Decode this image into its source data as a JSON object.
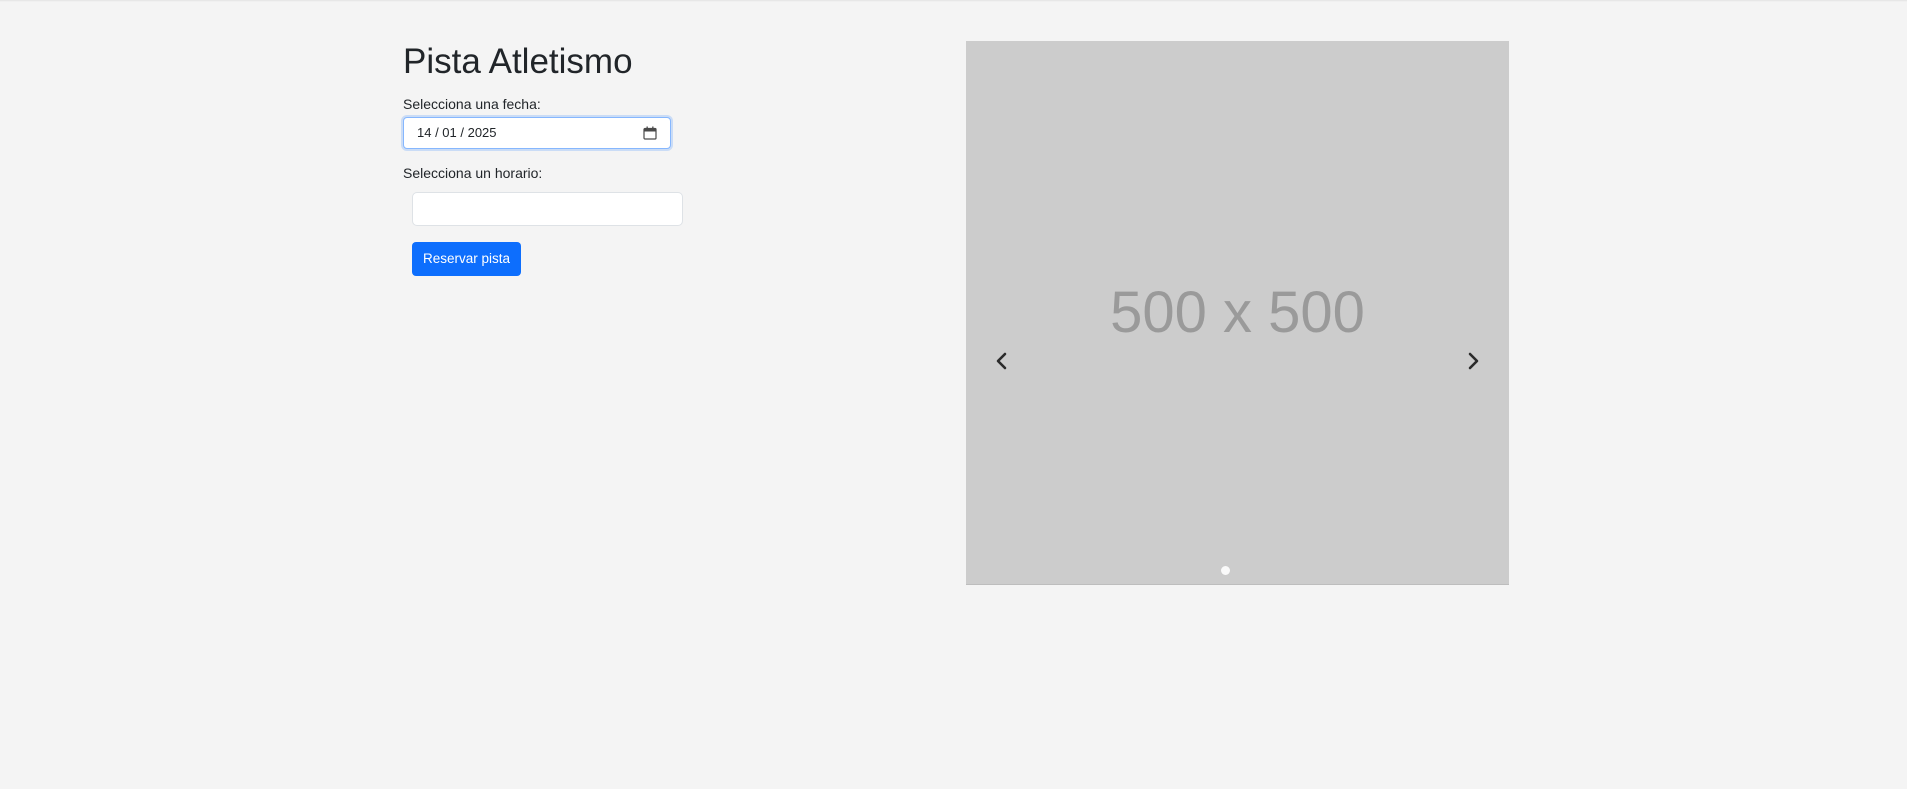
{
  "page": {
    "title": "Pista Atletismo"
  },
  "form": {
    "date_label": "Selecciona una fecha:",
    "date_value": "14 / 01 / 2025",
    "date_icon": "calendar-icon",
    "time_label": "Selecciona un horario:",
    "time_value": "",
    "submit_label": "Reservar pista"
  },
  "carousel": {
    "placeholder_text": "500 x 500",
    "prev_icon": "chevron-left-icon",
    "next_icon": "chevron-right-icon",
    "slide_count": 1,
    "active_slide": 1
  },
  "colors": {
    "background": "#f4f4f4",
    "primary_button": "#0d6efd",
    "placeholder_bg": "#cccccc",
    "placeholder_text": "#9a9a9a",
    "focus_border": "#86b7fe"
  }
}
